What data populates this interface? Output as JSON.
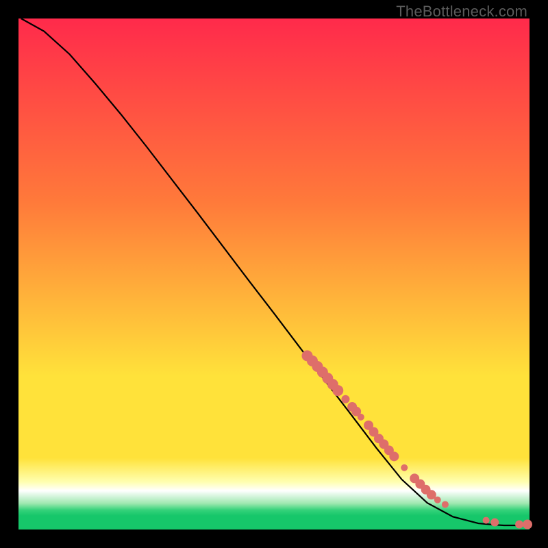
{
  "credit": "TheBottleneck.com",
  "colors": {
    "top": "#ff2a4b",
    "mid1": "#ff7a3a",
    "mid2": "#ffe23a",
    "band_pale": "#ffffb0",
    "band_white": "#ffffff",
    "band_green1": "#9fe8b0",
    "band_green2": "#35d27a",
    "band_green3": "#16c76a",
    "curve": "#000000",
    "marker": "#de6e6a"
  },
  "chart_data": {
    "type": "line",
    "title": "",
    "xlabel": "",
    "ylabel": "",
    "xlim": [
      0,
      100
    ],
    "ylim": [
      0,
      100
    ],
    "series": [
      {
        "name": "curve",
        "x": [
          0.5,
          5,
          10,
          15,
          20,
          25,
          30,
          35,
          40,
          45,
          50,
          55,
          60,
          65,
          70,
          75,
          80,
          85,
          90,
          93.5,
          95,
          97,
          99.8
        ],
        "y": [
          100,
          97.5,
          93.0,
          87.3,
          81.3,
          75.0,
          68.5,
          62.0,
          55.4,
          48.8,
          42.3,
          35.7,
          29.1,
          22.6,
          16.0,
          9.8,
          5.2,
          2.5,
          1.2,
          0.9,
          0.8,
          0.8,
          0.8
        ]
      }
    ],
    "markers": [
      {
        "x": 56.5,
        "y": 34.0,
        "r": 8
      },
      {
        "x": 57.5,
        "y": 33.0,
        "r": 8
      },
      {
        "x": 58.5,
        "y": 31.9,
        "r": 8
      },
      {
        "x": 59.5,
        "y": 30.8,
        "r": 8
      },
      {
        "x": 60.5,
        "y": 29.6,
        "r": 8
      },
      {
        "x": 61.5,
        "y": 28.4,
        "r": 8
      },
      {
        "x": 62.5,
        "y": 27.2,
        "r": 8
      },
      {
        "x": 64.0,
        "y": 25.5,
        "r": 6
      },
      {
        "x": 65.3,
        "y": 24.0,
        "r": 7
      },
      {
        "x": 66.1,
        "y": 23.1,
        "r": 7
      },
      {
        "x": 67.0,
        "y": 22.0,
        "r": 5
      },
      {
        "x": 68.5,
        "y": 20.4,
        "r": 7
      },
      {
        "x": 69.5,
        "y": 19.1,
        "r": 7
      },
      {
        "x": 70.5,
        "y": 17.8,
        "r": 7
      },
      {
        "x": 71.5,
        "y": 16.7,
        "r": 7
      },
      {
        "x": 72.5,
        "y": 15.5,
        "r": 7
      },
      {
        "x": 73.5,
        "y": 14.3,
        "r": 7
      },
      {
        "x": 75.5,
        "y": 12.1,
        "r": 5
      },
      {
        "x": 77.5,
        "y": 10.0,
        "r": 7
      },
      {
        "x": 78.6,
        "y": 8.9,
        "r": 7
      },
      {
        "x": 79.7,
        "y": 7.8,
        "r": 7
      },
      {
        "x": 80.8,
        "y": 6.8,
        "r": 7
      },
      {
        "x": 82.0,
        "y": 5.8,
        "r": 5
      },
      {
        "x": 83.5,
        "y": 4.9,
        "r": 5
      },
      {
        "x": 91.5,
        "y": 1.8,
        "r": 5
      },
      {
        "x": 93.2,
        "y": 1.4,
        "r": 6
      },
      {
        "x": 98.0,
        "y": 1.0,
        "r": 6
      },
      {
        "x": 99.6,
        "y": 1.0,
        "r": 7
      }
    ]
  }
}
